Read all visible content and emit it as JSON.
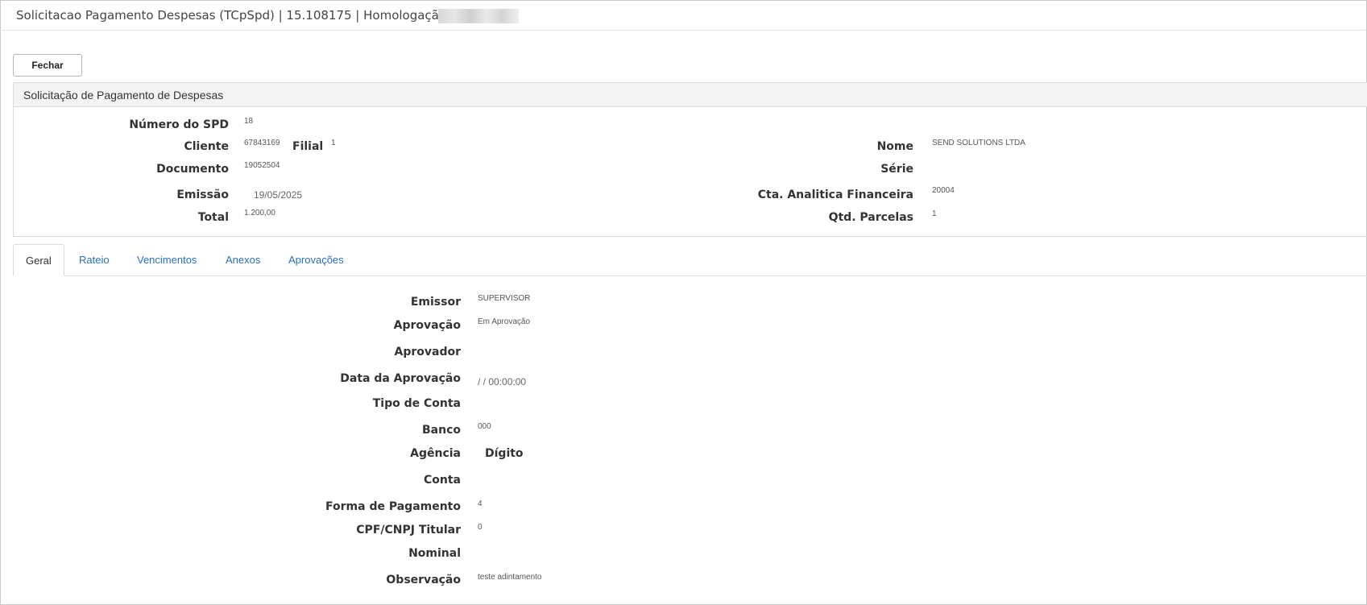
{
  "window": {
    "title": "Solicitacao Pagamento Despesas (TCpSpd) | 15.108175 | Homologação | S"
  },
  "toolbar": {
    "close_label": "Fechar"
  },
  "panel": {
    "title": "Solicitação de Pagamento de Despesas",
    "fields": {
      "numero_spd": {
        "label": "Número do SPD",
        "value": "18"
      },
      "cliente": {
        "label": "Cliente",
        "value": "67843169"
      },
      "filial": {
        "label": "Filial",
        "value": "1"
      },
      "nome": {
        "label": "Nome",
        "value": "SEND SOLUTIONS LTDA"
      },
      "documento": {
        "label": "Documento",
        "value": "19052504"
      },
      "serie": {
        "label": "Série",
        "value": ""
      },
      "emissao": {
        "label": "Emissão",
        "value": "19/05/2025"
      },
      "cta_analitica": {
        "label": "Cta. Analitica Financeira",
        "value": "20004"
      },
      "total": {
        "label": "Total",
        "value": "1.200,00"
      },
      "qtd_parcelas": {
        "label": "Qtd. Parcelas",
        "value": "1"
      }
    }
  },
  "tabs": [
    {
      "label": "Geral",
      "active": true
    },
    {
      "label": "Rateio"
    },
    {
      "label": "Vencimentos"
    },
    {
      "label": "Anexos"
    },
    {
      "label": "Aprovações"
    }
  ],
  "geral": {
    "emissor": {
      "label": "Emissor",
      "value": "SUPERVISOR"
    },
    "aprovacao": {
      "label": "Aprovação",
      "value": "Em Aprovação"
    },
    "aprovador": {
      "label": "Aprovador",
      "value": ""
    },
    "data_aprovacao": {
      "label": "Data da Aprovação",
      "value": "/ / 00:00:00"
    },
    "tipo_conta": {
      "label": "Tipo de Conta",
      "value": ""
    },
    "banco": {
      "label": "Banco",
      "value": "000"
    },
    "agencia": {
      "label": "Agência",
      "value": ""
    },
    "digito": {
      "label": "Dígito",
      "value": ""
    },
    "conta": {
      "label": "Conta",
      "value": ""
    },
    "forma_pagamento": {
      "label": "Forma de Pagamento",
      "value": "4"
    },
    "cpf_cnpj": {
      "label": "CPF/CNPJ Titular",
      "value": "0"
    },
    "nominal": {
      "label": "Nominal",
      "value": ""
    },
    "observacao": {
      "label": "Observação",
      "value": "teste adintamento"
    }
  }
}
